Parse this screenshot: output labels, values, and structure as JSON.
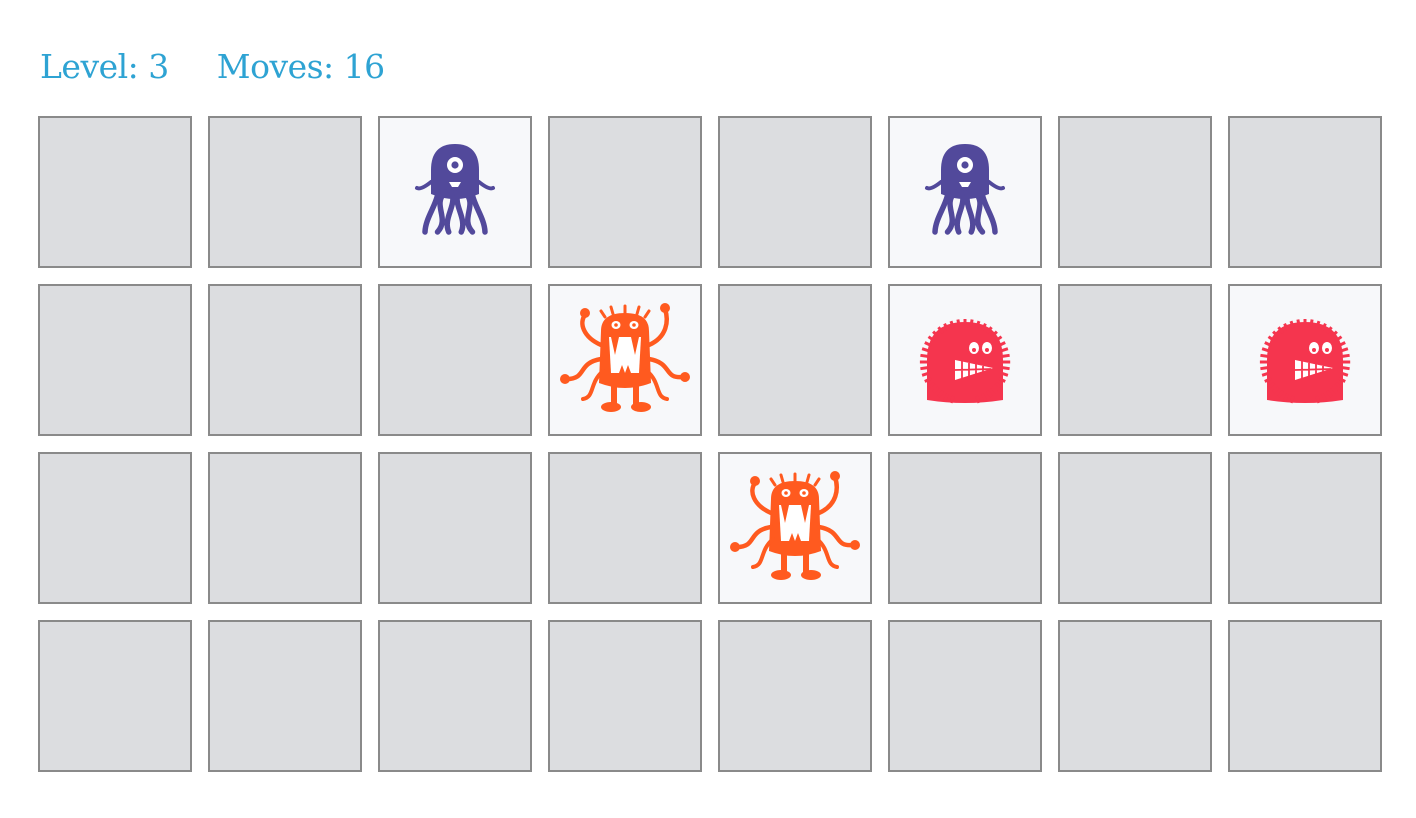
{
  "header": {
    "level_label": "Level: ",
    "level_value": "3",
    "moves_label": "Moves: ",
    "moves_value": "16"
  },
  "board": {
    "rows": 4,
    "columns": 8,
    "cards": [
      {
        "state": "hidden"
      },
      {
        "state": "hidden"
      },
      {
        "state": "revealed",
        "monster": "purple-octopus-monster",
        "color": "#52499b"
      },
      {
        "state": "hidden"
      },
      {
        "state": "hidden"
      },
      {
        "state": "revealed",
        "monster": "purple-octopus-monster",
        "color": "#52499b"
      },
      {
        "state": "hidden"
      },
      {
        "state": "hidden"
      },
      {
        "state": "hidden"
      },
      {
        "state": "hidden"
      },
      {
        "state": "hidden"
      },
      {
        "state": "revealed",
        "monster": "orange-tentacle-monster",
        "color": "#ff5a1f"
      },
      {
        "state": "hidden"
      },
      {
        "state": "revealed",
        "monster": "red-fuzzy-monster",
        "color": "#f5354e"
      },
      {
        "state": "hidden"
      },
      {
        "state": "revealed",
        "monster": "red-fuzzy-monster",
        "color": "#f5354e"
      },
      {
        "state": "hidden"
      },
      {
        "state": "hidden"
      },
      {
        "state": "hidden"
      },
      {
        "state": "hidden"
      },
      {
        "state": "revealed",
        "monster": "orange-tentacle-monster",
        "color": "#ff5a1f"
      },
      {
        "state": "hidden"
      },
      {
        "state": "hidden"
      },
      {
        "state": "hidden"
      },
      {
        "state": "hidden"
      },
      {
        "state": "hidden"
      },
      {
        "state": "hidden"
      },
      {
        "state": "hidden"
      },
      {
        "state": "hidden"
      },
      {
        "state": "hidden"
      },
      {
        "state": "hidden"
      },
      {
        "state": "hidden"
      }
    ]
  },
  "colors": {
    "header_text": "#2ea3d3",
    "card_back": "#dcdde0",
    "card_face": "#f7f8fa",
    "card_border": "#8a8a8a"
  }
}
